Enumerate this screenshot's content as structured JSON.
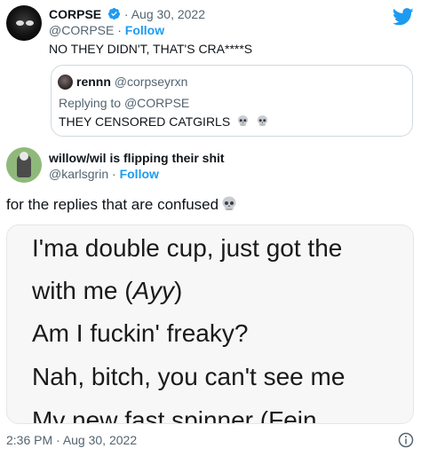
{
  "main_tweet": {
    "author_name": "CORPSE",
    "separator": "·",
    "date": "Aug 30, 2022",
    "handle": "@CORPSE",
    "follow_label": "Follow",
    "text": "NO THEY DIDN'T, THAT'S CRA****S"
  },
  "quoted_tweet": {
    "author_name": "rennn",
    "handle": "@corpseyrxn",
    "replying_prefix": "Replying to ",
    "replying_to": "@CORPSE",
    "text": "THEY CENSORED CATGIRLS"
  },
  "reply_tweet": {
    "author_name": "willow/wil is flipping their shit",
    "handle": "@karlsgrin",
    "follow_label": "Follow",
    "text": "for the replies that are confused"
  },
  "media": {
    "line1": "I'ma double cup, just got the",
    "line2_prefix": "with me (",
    "line2_italic": "Ayy",
    "line2_suffix": ")",
    "line3": "Am I fuckin' freaky?",
    "line4": "Nah, bitch, you can't see me",
    "line5": "My new fast spinner (Fein"
  },
  "footer": {
    "time": "2:36 PM",
    "date": "Aug 30, 2022"
  },
  "icons": {
    "verified": "verified-badge-icon",
    "twitter": "twitter-bird-icon",
    "skull": "skull-emoji-icon",
    "info": "info-icon"
  },
  "colors": {
    "accent": "#1d9bf0",
    "muted": "#536471",
    "text": "#0f1419",
    "border": "#cfd9de"
  }
}
